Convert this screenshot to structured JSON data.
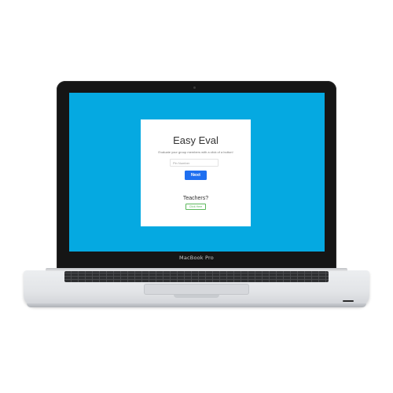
{
  "device": {
    "label": "MacBook Pro"
  },
  "app": {
    "title": "Easy Eval",
    "subtitle": "Evaluate your group members with a click of a button!",
    "pin_input": {
      "placeholder": "Pin Number",
      "value": ""
    },
    "next_label": "Next",
    "teachers_label": "Teachers?",
    "click_here_label": "Click Here"
  },
  "colors": {
    "screen_background": "#05a9e1",
    "card_background": "#ffffff",
    "primary_button": "#1f6ff0",
    "success_outline": "#5cb85c",
    "laptop_body": "#e2e4e7",
    "bezel": "#151515"
  }
}
